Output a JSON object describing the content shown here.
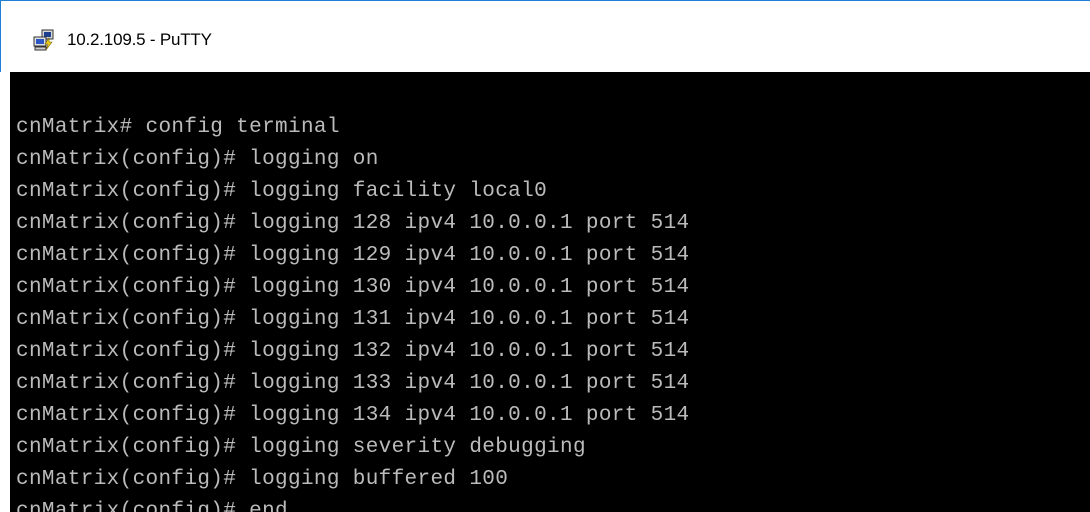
{
  "window": {
    "title": "10.2.109.5 - PuTTY",
    "icon": "putty-icon"
  },
  "terminal": {
    "background": "#000000",
    "foreground": "#bbbbbb",
    "lines": [
      "cnMatrix# config terminal",
      "cnMatrix(config)# logging on",
      "cnMatrix(config)# logging facility local0",
      "cnMatrix(config)# logging 128 ipv4 10.0.0.1 port 514",
      "cnMatrix(config)# logging 129 ipv4 10.0.0.1 port 514",
      "cnMatrix(config)# logging 130 ipv4 10.0.0.1 port 514",
      "cnMatrix(config)# logging 131 ipv4 10.0.0.1 port 514",
      "cnMatrix(config)# logging 132 ipv4 10.0.0.1 port 514",
      "cnMatrix(config)# logging 133 ipv4 10.0.0.1 port 514",
      "cnMatrix(config)# logging 134 ipv4 10.0.0.1 port 514",
      "cnMatrix(config)# logging severity debugging",
      "cnMatrix(config)# logging buffered 100",
      "cnMatrix(config)# end"
    ]
  }
}
